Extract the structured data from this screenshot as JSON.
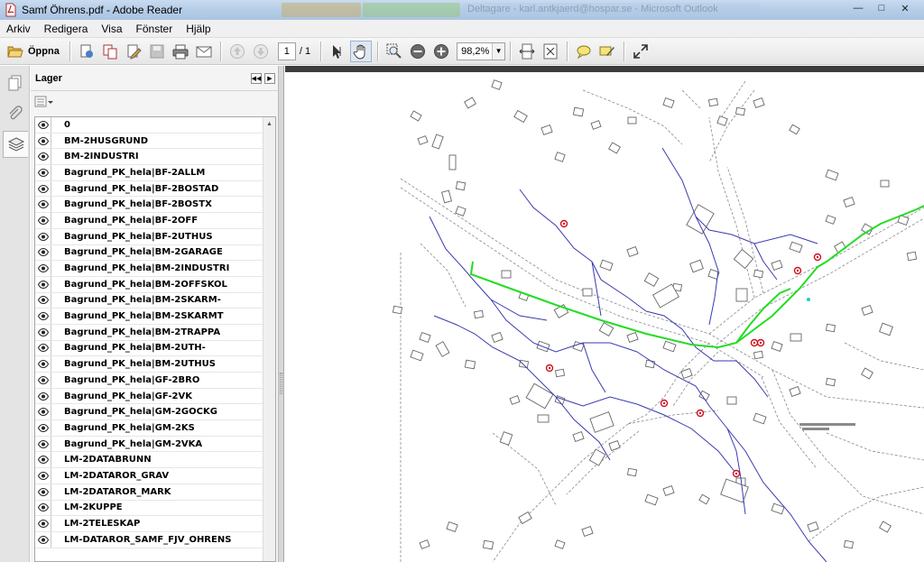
{
  "window": {
    "title": "Samf Öhrens.pdf - Adobe Reader",
    "bg_tabs": [
      "",
      "",
      "Deltagare - karl.antkjaerd@hospar.se - Microsoft Outlook"
    ]
  },
  "menu": [
    "Arkiv",
    "Redigera",
    "Visa",
    "Fönster",
    "Hjälp"
  ],
  "toolbar": {
    "open_label": "Öppna",
    "page_current": "1",
    "page_total": "/ 1",
    "zoom": "98,2%"
  },
  "panel": {
    "title": "Lager",
    "layers": [
      "0",
      "BM-2HUSGRUND",
      "BM-2INDUSTRI",
      "Bagrund_PK_hela|BF-2ALLM",
      "Bagrund_PK_hela|BF-2BOSTAD",
      "Bagrund_PK_hela|BF-2BOSTX",
      "Bagrund_PK_hela|BF-2OFF",
      "Bagrund_PK_hela|BF-2UTHUS",
      "Bagrund_PK_hela|BM-2GARAGE",
      "Bagrund_PK_hela|BM-2INDUSTRI",
      "Bagrund_PK_hela|BM-2OFFSKOL",
      "Bagrund_PK_hela|BM-2SKARM-",
      "Bagrund_PK_hela|BM-2SKARMT",
      "Bagrund_PK_hela|BM-2TRAPPA",
      "Bagrund_PK_hela|BM-2UTH-",
      "Bagrund_PK_hela|BM-2UTHUS",
      "Bagrund_PK_hela|GF-2BRO",
      "Bagrund_PK_hela|GF-2VK",
      "Bagrund_PK_hela|GM-2GOCKG",
      "Bagrund_PK_hela|GM-2KS",
      "Bagrund_PK_hela|GM-2VKA",
      "LM-2DATABRUNN",
      "LM-2DATAROR_GRAV",
      "LM-2DATAROR_MARK",
      "LM-2KUPPE",
      "LM-2TELESKAP",
      "LM-DATAROR_SAMF_FJV_OHRENS"
    ]
  },
  "colors": {
    "fiber_green": "#22dd22",
    "duct_blue": "#3a3ab0",
    "well_red": "#d01020",
    "road_gray": "#8a8a8a"
  },
  "icons": {
    "file": "pdf-file-icon",
    "open": "folder-open-icon",
    "pages": "pages-icon",
    "attachments": "paperclip-icon",
    "layers": "layers-icon",
    "eye": "eye-icon"
  }
}
